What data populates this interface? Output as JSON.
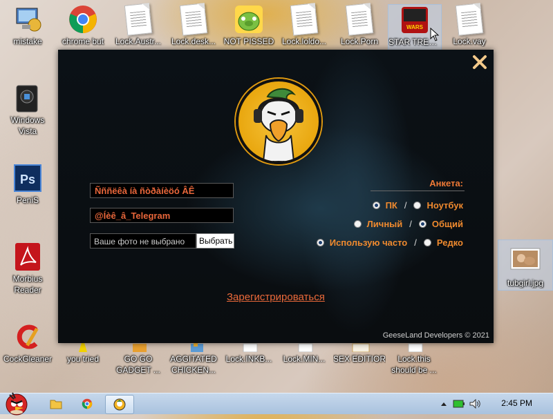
{
  "desktop": {
    "top_row": [
      {
        "label": "mistake",
        "icon": "computer-settings-icon"
      },
      {
        "label": "chrome but",
        "icon": "chrome-icon"
      },
      {
        "label": "Lock.Austr...",
        "icon": "document-icon"
      },
      {
        "label": "Lock.desk...",
        "icon": "document-icon"
      },
      {
        "label": "NOT PISSED",
        "icon": "angry-birds-pig-icon"
      },
      {
        "label": "Lock.loldo...",
        "icon": "document-icon"
      },
      {
        "label": "Lock.Porn",
        "icon": "document-icon"
      },
      {
        "label": "STAR TREK 3",
        "icon": "star-wars-game-icon"
      },
      {
        "label": "Lock.vay",
        "icon": "document-icon"
      }
    ],
    "left_col": [
      {
        "label": "Windows Vista",
        "icon": "windows-vista-box-icon"
      },
      {
        "label": "PeniS",
        "icon": "photoshop-icon"
      },
      {
        "label": "Morbius Reader",
        "icon": "adobe-reader-icon"
      }
    ],
    "bottom_row": [
      {
        "label": "CockGleaner",
        "icon": "ccleaner-icon"
      },
      {
        "label": "you tried",
        "icon": "star-icon"
      },
      {
        "label": "GO GO GADGET ...",
        "icon": "folder-icon"
      },
      {
        "label": "AGGITATED CHICKEN...",
        "icon": "game-icon"
      },
      {
        "label": "Lock.INKB...",
        "icon": "document-icon"
      },
      {
        "label": "Lock.MIN...",
        "icon": "document-icon"
      },
      {
        "label": "SEX EDITIOR",
        "icon": "editor-icon"
      },
      {
        "label": "Lock.this should be ...",
        "icon": "document-icon"
      }
    ],
    "right_file": {
      "label": "tubgirl.jpg",
      "icon": "image-file-icon"
    }
  },
  "dialog": {
    "close_symbol": "✕",
    "field_name": "Ñññëêà íà ñòðàíèöó ÂÊ",
    "field_telegram": "@Íèê_â_Telegram",
    "photo_placeholder": "Ваше фото не выбрано",
    "photo_button": "Выбрать",
    "form_title": "Анкета:",
    "radio_rows": [
      {
        "a": "ПК",
        "b": "Ноутбук",
        "selected": "a"
      },
      {
        "a": "Личный",
        "b": "Общий",
        "selected": "b"
      },
      {
        "a": "Использую часто",
        "b": "Редко",
        "selected": "a"
      }
    ],
    "separator": "/",
    "register_link": "Зарегистрироваться",
    "footer": "GeeseLand Developers © 2021"
  },
  "taskbar": {
    "clock": "2:45 PM"
  },
  "colors": {
    "accent_orange": "#f08a2e",
    "dialog_bg": "#0b1116"
  }
}
